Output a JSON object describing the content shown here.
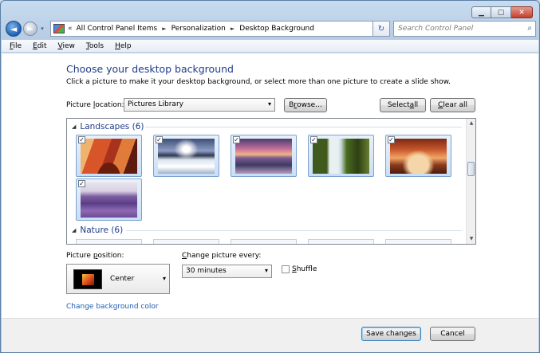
{
  "window": {
    "caption": {
      "minimize": "▁",
      "maximize": "▢",
      "close": "✕"
    }
  },
  "nav": {
    "back_glyph": "◄",
    "forward_glyph": "►",
    "history_glyph": "▾",
    "address_overflow": "«",
    "breadcrumbs": [
      "All Control Panel Items",
      "Personalization",
      "Desktop Background"
    ],
    "breadcrumb_sep": "►",
    "address_dropdown": "▾",
    "refresh_glyph": "↻",
    "search_placeholder": "Search Control Panel",
    "search_glyph": "⌕"
  },
  "menu": [
    {
      "acc": "F",
      "rest": "ile"
    },
    {
      "acc": "E",
      "rest": "dit"
    },
    {
      "acc": "V",
      "rest": "iew"
    },
    {
      "acc": "T",
      "rest": "ools"
    },
    {
      "acc": "H",
      "rest": "elp"
    }
  ],
  "page": {
    "title": "Choose your desktop background",
    "description": "Click a picture to make it your desktop background, or select more than one picture to create a slide show.",
    "location_label_pre": "Picture ",
    "location_label_acc": "l",
    "location_label_post": "ocation:",
    "location_value": "Pictures Library",
    "dropdown_glyph": "▾",
    "browse_pre": "B",
    "browse_acc": "r",
    "browse_post": "owse...",
    "select_all_pre": "Select ",
    "select_all_acc": "a",
    "select_all_post": "ll",
    "clear_all_pre": "",
    "clear_all_acc": "C",
    "clear_all_post": "lear all"
  },
  "gallery": {
    "groups": [
      {
        "title": "Landscapes (6)",
        "arrow": "◢"
      },
      {
        "title": "Nature (6)",
        "arrow": "◢"
      }
    ],
    "checkmark": "✓",
    "landscapes": [
      {
        "name": "canyon",
        "checked": true
      },
      {
        "name": "icy-lake",
        "checked": true
      },
      {
        "name": "sunset-sea",
        "checked": true
      },
      {
        "name": "waterfall",
        "checked": true
      },
      {
        "name": "rock-arch",
        "checked": true
      },
      {
        "name": "lavender-field",
        "checked": true
      }
    ],
    "scroll_up": "▲",
    "scroll_down": "▼"
  },
  "position": {
    "label_pre": "Picture ",
    "label_acc": "p",
    "label_post": "osition:",
    "value": "Center"
  },
  "interval": {
    "label_pre": "",
    "label_acc": "C",
    "label_post": "hange picture every:",
    "value": "30 minutes"
  },
  "shuffle": {
    "label_pre": "",
    "label_acc": "S",
    "label_post": "huffle",
    "checked": false
  },
  "links": {
    "background_color": "Change background color"
  },
  "footer": {
    "save": "Save changes",
    "cancel": "Cancel"
  },
  "colors": {
    "title_blue": "#1e3b8a",
    "link_blue": "#1e5cb3",
    "selection_blue": "#c9dff6"
  }
}
